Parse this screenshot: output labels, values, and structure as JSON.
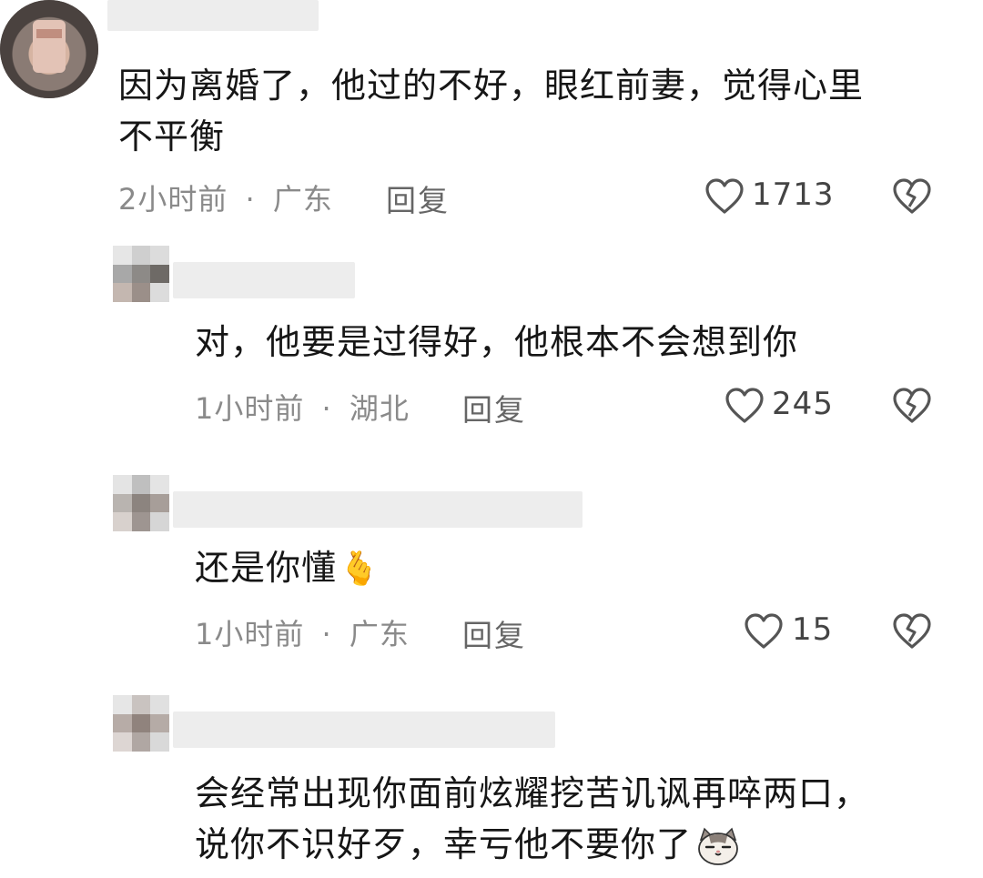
{
  "comments": [
    {
      "text_lines": [
        "因为离婚了，他过的不好，眼红前妻，觉得心里",
        "不平衡"
      ],
      "time": "2小时前",
      "sep": "·",
      "location": "广东",
      "reply_label": "回复",
      "likes": "1713"
    },
    {
      "text_lines": [
        "对，他要是过得好，他根本不会想到你"
      ],
      "time": "1小时前",
      "sep": "·",
      "location": "湖北",
      "reply_label": "回复",
      "likes": "245"
    },
    {
      "text_lines": [
        "还是你懂"
      ],
      "emoji": "🫰",
      "time": "1小时前",
      "sep": "·",
      "location": "广东",
      "reply_label": "回复",
      "likes": "15"
    },
    {
      "text_lines": [
        "会经常出现你面前炫耀挖苦讥讽再啐两口，",
        "说你不识好歹，幸亏他不要你了"
      ],
      "emoji": "cat-face-sticker"
    }
  ],
  "icons": {
    "like": "heart-outline-icon",
    "dislike": "broken-heart-icon"
  },
  "colors": {
    "text": "#161616",
    "meta": "#8a8a8a",
    "icon": "#555555"
  }
}
